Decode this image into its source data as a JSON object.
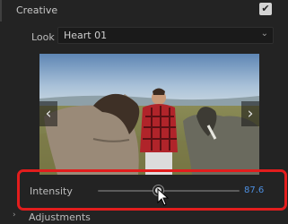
{
  "section": {
    "title": "Creative",
    "enabled": true,
    "check_glyph": "✔"
  },
  "look": {
    "label": "Look",
    "value": "Heart 01",
    "chevron": "⌄"
  },
  "preview": {
    "prev_glyph": "‹",
    "next_glyph": "›"
  },
  "intensity": {
    "label": "Intensity",
    "value": "87.6",
    "level": 87.6,
    "value_color": "#4d8fe0"
  },
  "highlight": {
    "color": "#e21d1d"
  },
  "adjustments": {
    "label": "Adjustments",
    "chevron": "›"
  }
}
